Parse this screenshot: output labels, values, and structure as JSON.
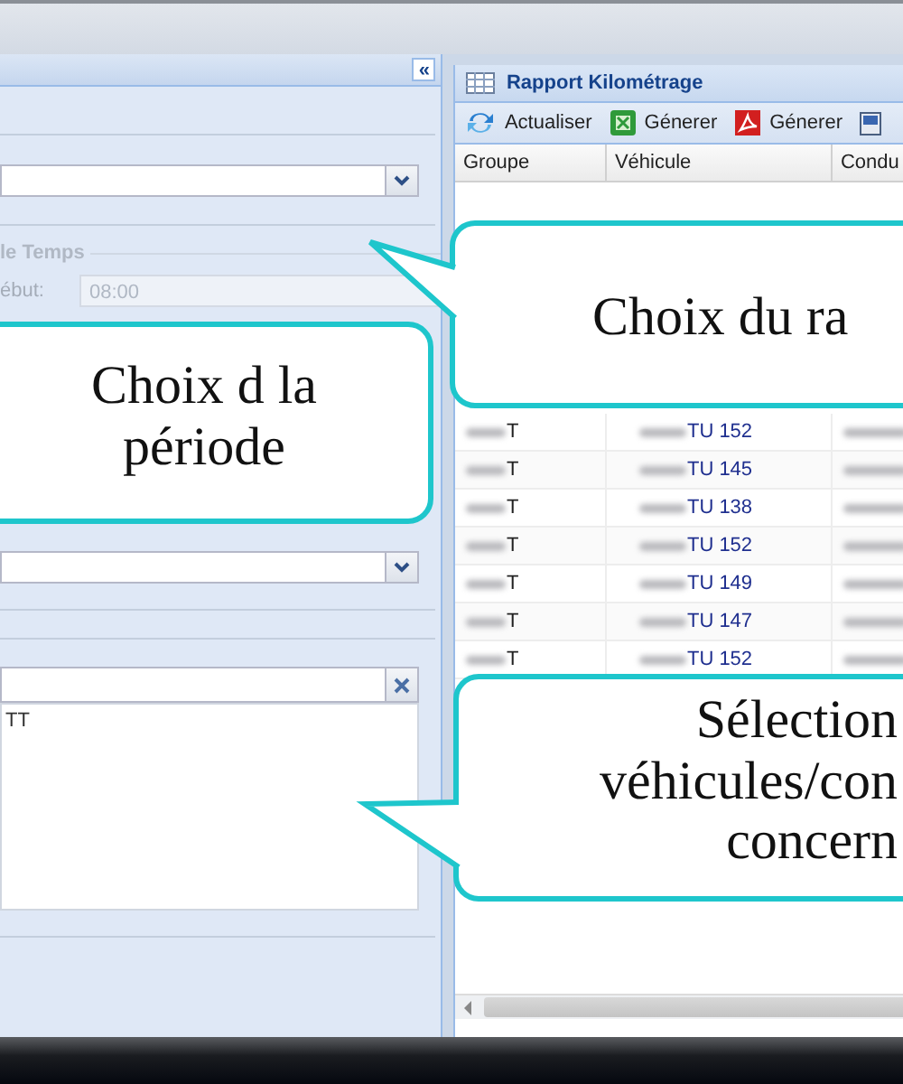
{
  "left_panel": {
    "collapse_button": "«",
    "legend": "le Temps",
    "start_label": "ébut:",
    "start_field": {
      "value": "08:00",
      "disabled": true
    },
    "list_items": [
      "TT"
    ]
  },
  "report": {
    "title": "Rapport Kilométrage",
    "toolbar": [
      {
        "kind": "refresh",
        "label": "Actualiser"
      },
      {
        "kind": "excel",
        "label": "Génerer"
      },
      {
        "kind": "pdf",
        "label": "Génerer"
      },
      {
        "kind": "print"
      }
    ],
    "columns": [
      "Groupe",
      "Véhicule",
      "Condu"
    ],
    "rows": [
      {
        "group": "T",
        "vehicle": "TU 152"
      },
      {
        "group": "T",
        "vehicle": "TU 145"
      },
      {
        "group": "T",
        "vehicle": "TU 138"
      },
      {
        "group": "T",
        "vehicle": "TU 152"
      },
      {
        "group": "T",
        "vehicle": "TU 149"
      },
      {
        "group": "T",
        "vehicle": "TU 147"
      },
      {
        "group": "T",
        "vehicle": "TU 152"
      }
    ]
  },
  "callouts": [
    {
      "text": "Choix d la\npériode"
    },
    {
      "text": "Choix du ra"
    },
    {
      "text": "Sélection\nvéhicules/con\nconcern"
    }
  ]
}
